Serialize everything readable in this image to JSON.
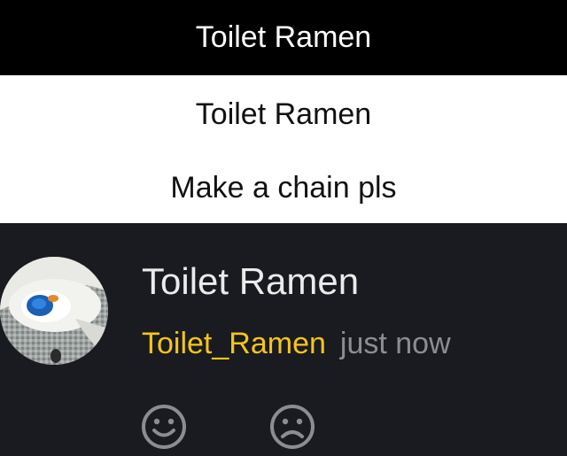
{
  "header": {
    "title": "Toilet Ramen"
  },
  "caption": {
    "line1": "Toilet Ramen",
    "line2": "Make a chain pls"
  },
  "post": {
    "title": "Toilet Ramen",
    "username": "Toilet_Ramen",
    "timestamp": "just now",
    "avatar_icon": "toilet-photo-avatar",
    "reactions": [
      {
        "icon": "happy-face-icon"
      },
      {
        "icon": "sad-face-icon"
      }
    ]
  },
  "colors": {
    "header_bg": "#000000",
    "caption_bg": "#ffffff",
    "post_bg": "#1a1b20",
    "username": "#f5c518",
    "timestamp": "#8c8d92",
    "reaction_icon": "#8c8d92"
  }
}
